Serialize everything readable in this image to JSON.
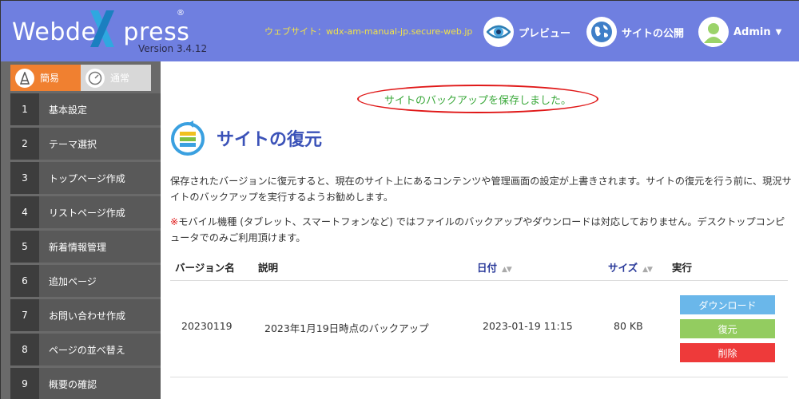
{
  "header": {
    "logo": "WebdeXpress",
    "logo_reg": "®",
    "version": "Version 3.4.12",
    "site_label": "ウェブサイト：wdx-am-manual-jp.secure-web.jp",
    "preview_label": "プレビュー",
    "publish_label": "サイトの公開",
    "admin_label": "Admin",
    "colors": {
      "bar": "#6f7fe0",
      "url": "#f0e14a",
      "logo_x": "#2fa8e0"
    }
  },
  "sidebar": {
    "modes": [
      {
        "label": "簡易",
        "icon": "tower-icon",
        "active": true
      },
      {
        "label": "通常",
        "icon": "gauge-icon",
        "active": false
      }
    ],
    "items": [
      {
        "num": "1",
        "label": "基本設定"
      },
      {
        "num": "2",
        "label": "テーマ選択"
      },
      {
        "num": "3",
        "label": "トップページ作成"
      },
      {
        "num": "4",
        "label": "リストページ作成"
      },
      {
        "num": "5",
        "label": "新着情報管理"
      },
      {
        "num": "6",
        "label": "追加ページ"
      },
      {
        "num": "7",
        "label": "お問い合わせ作成"
      },
      {
        "num": "8",
        "label": "ページの並べ替え"
      },
      {
        "num": "9",
        "label": "概要の確認"
      }
    ]
  },
  "main": {
    "notice": "サイトのバックアップを保存しました。",
    "title": "サイトの復元",
    "description": "保存されたバージョンに復元すると、現在のサイト上にあるコンテンツや管理画面の設定が上書きされます。サイトの復元を行う前に、現況サイトのバックアップを実行するようお勧めします。",
    "warning_mark": "※",
    "warning": "モバイル機種 (タブレット、スマートフォンなど) ではファイルのバックアップやダウンロードは対応しておりません。デスクトップコンピュータでのみご利用頂けます。",
    "table": {
      "headers": {
        "version": "バージョン名",
        "description": "説明",
        "date": "日付",
        "size": "サイズ",
        "action": "実行"
      },
      "rows": [
        {
          "version": "20230119",
          "description": "2023年1月19日時点のバックアップ",
          "date": "2023-01-19 11:15",
          "size": "80 KB"
        }
      ],
      "actions": {
        "download": "ダウンロード",
        "restore": "復元",
        "delete": "削除"
      }
    }
  }
}
